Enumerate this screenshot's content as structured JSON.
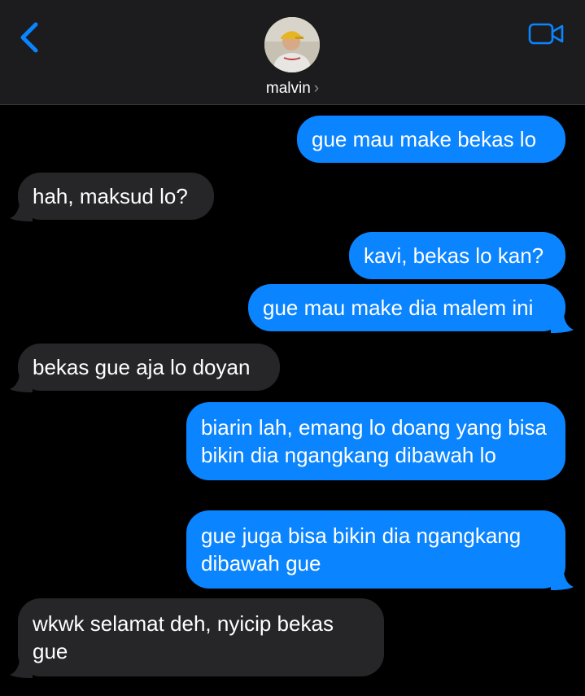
{
  "header": {
    "contact_name": "malvin",
    "chevron": "›",
    "back_icon": "chevron-left-icon",
    "video_icon": "video-camera-icon",
    "accent": "#0a84ff"
  },
  "messages": [
    {
      "direction": "outgoing",
      "text": "gue mau make bekas lo"
    },
    {
      "direction": "incoming",
      "text": "hah, maksud lo?"
    },
    {
      "direction": "outgoing",
      "text": "kavi, bekas lo kan?"
    },
    {
      "direction": "outgoing",
      "text": "gue mau make dia malem ini"
    },
    {
      "direction": "incoming",
      "text": "bekas gue aja lo doyan"
    },
    {
      "direction": "outgoing",
      "text": "biarin lah, emang lo doang yang bisa bikin dia ngangkang dibawah lo"
    },
    {
      "direction": "outgoing",
      "text": "gue juga bisa bikin dia ngangkang dibawah gue"
    },
    {
      "direction": "incoming",
      "text": "wkwk selamat deh, nyicip bekas gue"
    }
  ],
  "colors": {
    "outgoing_bubble": "#0a84ff",
    "incoming_bubble": "#262628",
    "background": "#000000",
    "header": "#1c1c1e"
  }
}
